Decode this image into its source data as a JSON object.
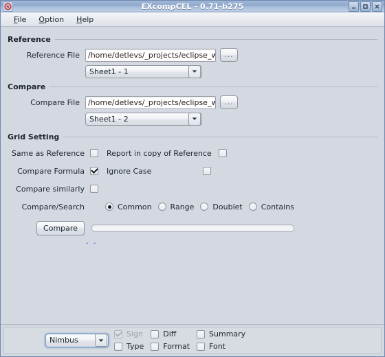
{
  "window": {
    "title": "EXcompCEL - 0.71-b275",
    "app_icon": "app-icon",
    "minimize_label": "Minimize",
    "maximize_label": "Maximize",
    "close_label": "Close"
  },
  "menubar": {
    "items": [
      {
        "label": "File",
        "mnemonic": "F"
      },
      {
        "label": "Option",
        "mnemonic": "O"
      },
      {
        "label": "Help",
        "mnemonic": "H"
      }
    ]
  },
  "reference": {
    "group_title": "Reference",
    "file_label": "Reference File",
    "file_value": "/home/detlevs/_projects/eclipse_work",
    "browse_label": "...",
    "sheet_value": "Sheet1 - 1"
  },
  "compare": {
    "group_title": "Compare",
    "file_label": "Compare File",
    "file_value": "/home/detlevs/_projects/eclipse_work",
    "browse_label": "...",
    "sheet_value": "Sheet1 - 2"
  },
  "grid_setting": {
    "group_title": "Grid Setting",
    "same_as_reference": {
      "label": "Same as Reference",
      "checked": false
    },
    "report_in_copy": {
      "label": "Report in copy of Reference",
      "checked": false
    },
    "compare_formula": {
      "label": "Compare Formula",
      "checked": true
    },
    "ignore_case": {
      "label": "Ignore Case",
      "checked": false
    },
    "extra_checkbox": {
      "checked": false
    },
    "compare_similarly": {
      "label": "Compare similarly",
      "checked": false
    },
    "compare_search": {
      "label": "Compare/Search",
      "selected": "Common",
      "options": [
        "Common",
        "Range",
        "Doublet",
        "Contains"
      ]
    }
  },
  "action": {
    "compare_button": "Compare",
    "progress_value": 0,
    "status_text": "- -"
  },
  "bottom": {
    "look_and_feel": "Nimbus",
    "checks": [
      {
        "label": "Sign",
        "checked": true,
        "disabled": true
      },
      {
        "label": "Diff",
        "checked": false,
        "disabled": false
      },
      {
        "label": "Summary",
        "checked": false,
        "disabled": false
      },
      {
        "label": "Type",
        "checked": false,
        "disabled": false
      },
      {
        "label": "Format",
        "checked": false,
        "disabled": false
      },
      {
        "label": "Font",
        "checked": false,
        "disabled": false
      }
    ]
  },
  "colors": {
    "titlebar": "#93abcd",
    "panel": "#d4d8e0",
    "accent": "#3c3ce0",
    "text": "#1b2430"
  }
}
